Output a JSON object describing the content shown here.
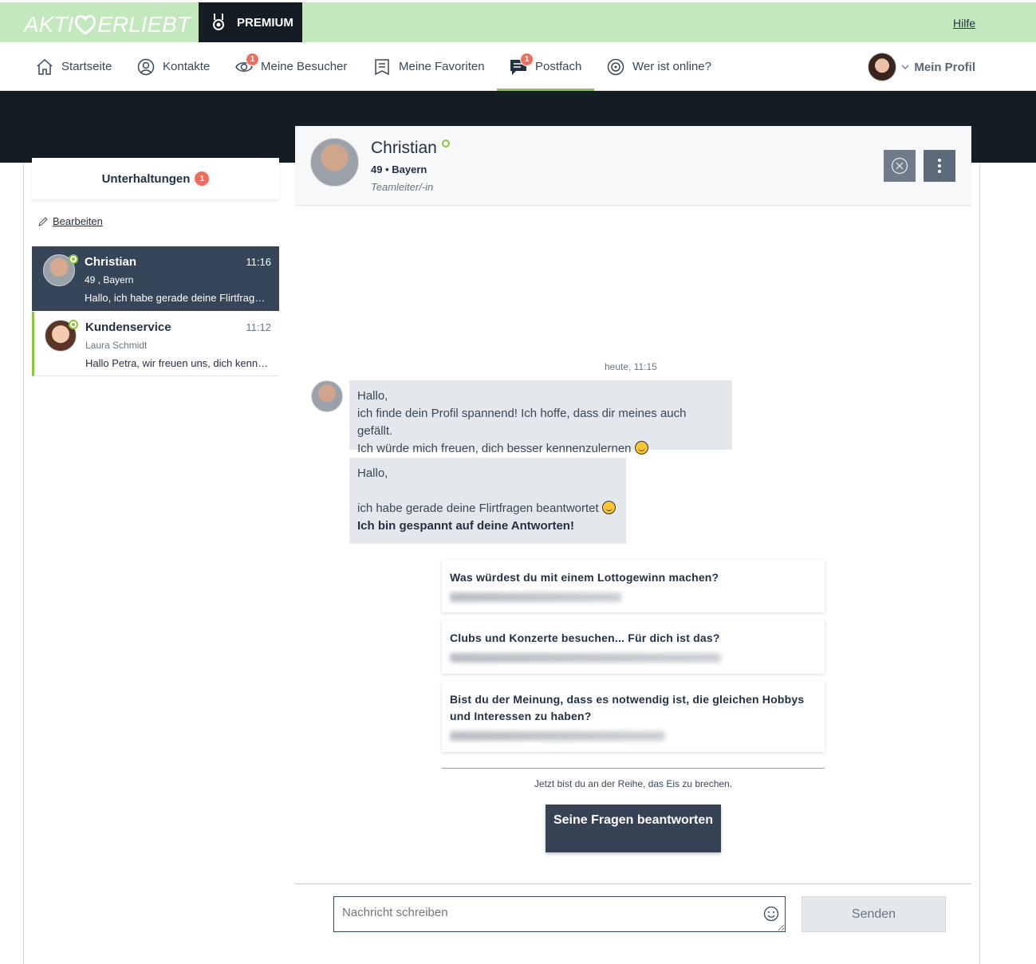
{
  "brand": {
    "logo_text_left": "AKTI",
    "logo_text_right": "ERLIEBT",
    "premium_label": "PREMIUM",
    "help_link": "Hilfe"
  },
  "nav": {
    "items": [
      {
        "label": "Startseite",
        "icon": "home-icon"
      },
      {
        "label": "Kontakte",
        "icon": "user-icon"
      },
      {
        "label": "Meine Besucher",
        "icon": "eye-icon",
        "badge": "1"
      },
      {
        "label": "Meine Favoriten",
        "icon": "bookmark-icon"
      },
      {
        "label": "Postfach",
        "icon": "chat-icon",
        "badge": "1",
        "active": true
      },
      {
        "label": "Wer ist online?",
        "icon": "online-icon"
      }
    ],
    "profile_label": "Mein Profil"
  },
  "sidebar": {
    "title": "Unterhaltungen",
    "count": "1",
    "edit_label": "Bearbeiten",
    "conversations": [
      {
        "name": "Christian",
        "time": "11:16",
        "sub": "49 , Bayern",
        "preview": "Hallo, ich habe gerade deine Flirtfragen beantwortet",
        "active": true
      },
      {
        "name": "Kundenservice",
        "time": "11:12",
        "sub": "Laura Schmidt",
        "preview": "Hallo Petra, wir freuen uns, dich kennenzulernen"
      }
    ]
  },
  "chat": {
    "name": "Christian",
    "meta": "49 • Bayern",
    "job": "Teamleiter/-in",
    "date_label": "heute, 11:15",
    "messages": [
      {
        "lines": [
          "Hallo,",
          "ich finde dein Profil spannend! Ich hoffe, dass dir meines auch gefällt.",
          "Ich würde mich freuen, dich besser kennenzulernen"
        ]
      },
      {
        "line1": "Hallo,",
        "line2": "ich habe gerade deine Flirtfragen beantwortet",
        "line3": "Ich bin gespannt auf deine Antworten!"
      }
    ],
    "questions": [
      "Was würdest du mit einem Lottogewinn machen?",
      "Clubs und Konzerte besuchen... Für dich ist das?",
      "Bist du der Meinung, dass es notwendig ist, die gleichen Hobbys und Interessen zu haben?"
    ],
    "hint": "Jetzt bist du an der Reihe, das Eis zu brechen.",
    "answer_button": "Seine Fragen beantworten",
    "input_placeholder": "Nachricht schreiben",
    "send_label": "Senden"
  },
  "colors": {
    "brand_green": "#8cc63f",
    "topbar": "#c3e8bd",
    "dark": "#141c24",
    "primary": "#364355",
    "badge": "#f26b5b"
  }
}
